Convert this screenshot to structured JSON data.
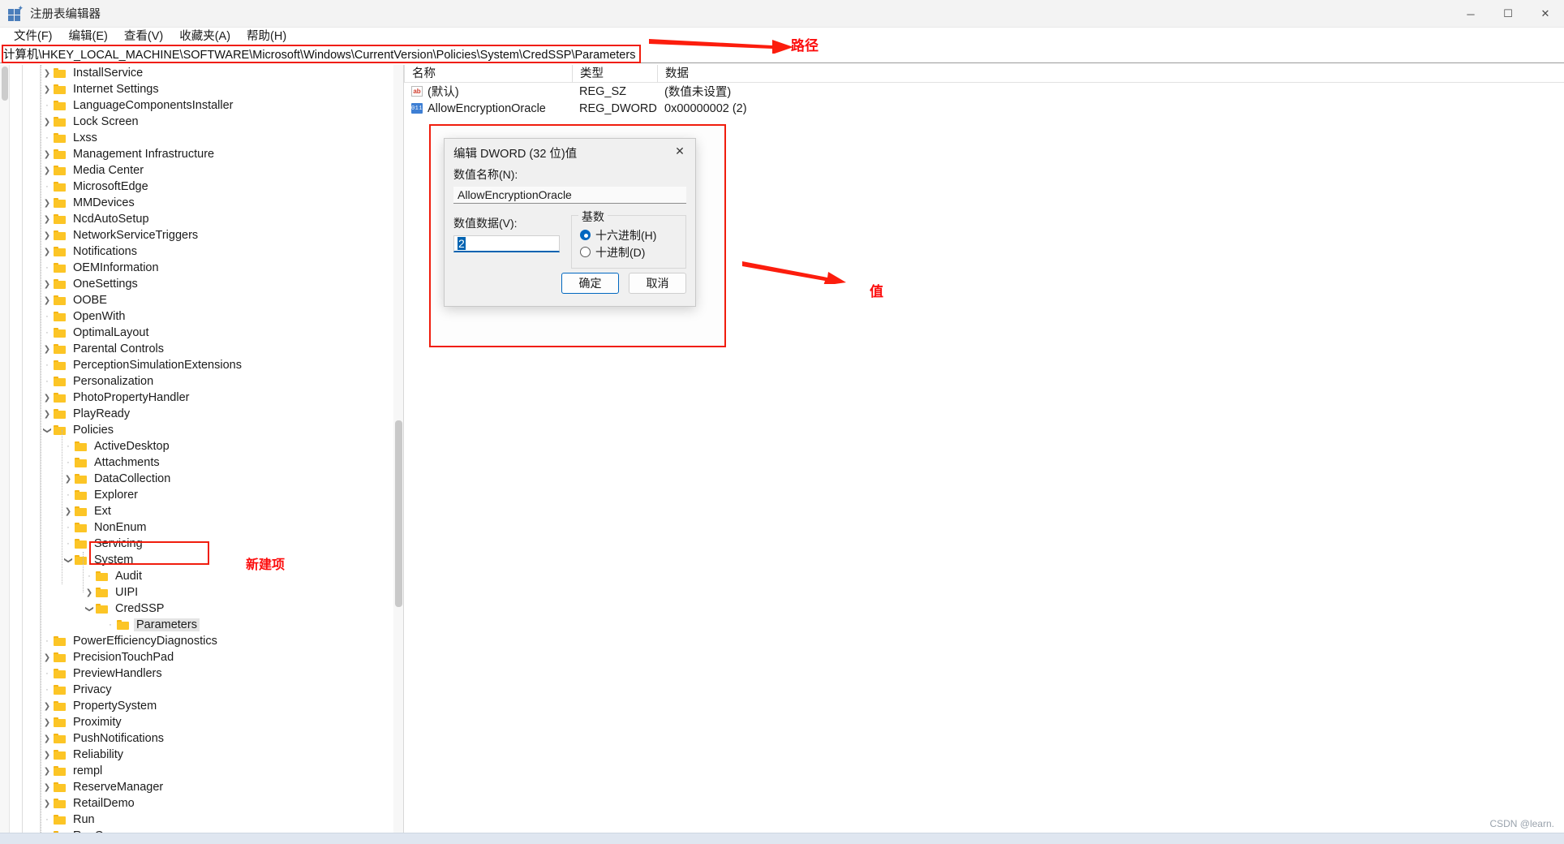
{
  "window": {
    "title": "注册表编辑器",
    "icon": "registry-icon",
    "controls": {
      "minimize": "─",
      "maximize": "☐",
      "close": "✕"
    }
  },
  "menubar": {
    "items": [
      {
        "label": "文件(F)",
        "name": "menu-file"
      },
      {
        "label": "编辑(E)",
        "name": "menu-edit"
      },
      {
        "label": "查看(V)",
        "name": "menu-view"
      },
      {
        "label": "收藏夹(A)",
        "name": "menu-favorites"
      },
      {
        "label": "帮助(H)",
        "name": "menu-help"
      }
    ]
  },
  "address": {
    "path": "计算机\\HKEY_LOCAL_MACHINE\\SOFTWARE\\Microsoft\\Windows\\CurrentVersion\\Policies\\System\\CredSSP\\Parameters",
    "placeholder": "计算机\\"
  },
  "tree": {
    "nodes": [
      {
        "label": "InstallService",
        "indent": 1,
        "expander": "collapsed"
      },
      {
        "label": "Internet Settings",
        "indent": 1,
        "expander": "collapsed"
      },
      {
        "label": "LanguageComponentsInstaller",
        "indent": 1,
        "expander": "none"
      },
      {
        "label": "Lock Screen",
        "indent": 1,
        "expander": "collapsed"
      },
      {
        "label": "Lxss",
        "indent": 1,
        "expander": "none"
      },
      {
        "label": "Management Infrastructure",
        "indent": 1,
        "expander": "collapsed"
      },
      {
        "label": "Media Center",
        "indent": 1,
        "expander": "collapsed"
      },
      {
        "label": "MicrosoftEdge",
        "indent": 1,
        "expander": "none"
      },
      {
        "label": "MMDevices",
        "indent": 1,
        "expander": "collapsed"
      },
      {
        "label": "NcdAutoSetup",
        "indent": 1,
        "expander": "collapsed"
      },
      {
        "label": "NetworkServiceTriggers",
        "indent": 1,
        "expander": "collapsed"
      },
      {
        "label": "Notifications",
        "indent": 1,
        "expander": "collapsed"
      },
      {
        "label": "OEMInformation",
        "indent": 1,
        "expander": "none"
      },
      {
        "label": "OneSettings",
        "indent": 1,
        "expander": "collapsed"
      },
      {
        "label": "OOBE",
        "indent": 1,
        "expander": "collapsed"
      },
      {
        "label": "OpenWith",
        "indent": 1,
        "expander": "none"
      },
      {
        "label": "OptimalLayout",
        "indent": 1,
        "expander": "none"
      },
      {
        "label": "Parental Controls",
        "indent": 1,
        "expander": "collapsed"
      },
      {
        "label": "PerceptionSimulationExtensions",
        "indent": 1,
        "expander": "none"
      },
      {
        "label": "Personalization",
        "indent": 1,
        "expander": "none"
      },
      {
        "label": "PhotoPropertyHandler",
        "indent": 1,
        "expander": "collapsed"
      },
      {
        "label": "PlayReady",
        "indent": 1,
        "expander": "collapsed"
      },
      {
        "label": "Policies",
        "indent": 1,
        "expander": "expanded"
      },
      {
        "label": "ActiveDesktop",
        "indent": 2,
        "expander": "none"
      },
      {
        "label": "Attachments",
        "indent": 2,
        "expander": "none"
      },
      {
        "label": "DataCollection",
        "indent": 2,
        "expander": "collapsed"
      },
      {
        "label": "Explorer",
        "indent": 2,
        "expander": "none"
      },
      {
        "label": "Ext",
        "indent": 2,
        "expander": "collapsed"
      },
      {
        "label": "NonEnum",
        "indent": 2,
        "expander": "none"
      },
      {
        "label": "Servicing",
        "indent": 2,
        "expander": "none"
      },
      {
        "label": "System",
        "indent": 2,
        "expander": "expanded"
      },
      {
        "label": "Audit",
        "indent": 3,
        "expander": "none"
      },
      {
        "label": "UIPI",
        "indent": 3,
        "expander": "collapsed"
      },
      {
        "label": "CredSSP",
        "indent": 3,
        "expander": "expanded"
      },
      {
        "label": "Parameters",
        "indent": 4,
        "expander": "none",
        "selected": true
      },
      {
        "label": "PowerEfficiencyDiagnostics",
        "indent": 1,
        "expander": "none"
      },
      {
        "label": "PrecisionTouchPad",
        "indent": 1,
        "expander": "collapsed"
      },
      {
        "label": "PreviewHandlers",
        "indent": 1,
        "expander": "none"
      },
      {
        "label": "Privacy",
        "indent": 1,
        "expander": "none"
      },
      {
        "label": "PropertySystem",
        "indent": 1,
        "expander": "collapsed"
      },
      {
        "label": "Proximity",
        "indent": 1,
        "expander": "collapsed"
      },
      {
        "label": "PushNotifications",
        "indent": 1,
        "expander": "collapsed"
      },
      {
        "label": "Reliability",
        "indent": 1,
        "expander": "collapsed"
      },
      {
        "label": "rempl",
        "indent": 1,
        "expander": "collapsed"
      },
      {
        "label": "ReserveManager",
        "indent": 1,
        "expander": "collapsed"
      },
      {
        "label": "RetailDemo",
        "indent": 1,
        "expander": "collapsed"
      },
      {
        "label": "Run",
        "indent": 1,
        "expander": "none"
      },
      {
        "label": "RunOnce",
        "indent": 1,
        "expander": "none"
      }
    ]
  },
  "valuelist": {
    "columns": {
      "name": "名称",
      "type": "类型",
      "data": "数据"
    },
    "rows": [
      {
        "icon": "string-value-icon",
        "name": "(默认)",
        "type": "REG_SZ",
        "data": "(数值未设置)"
      },
      {
        "icon": "dword-value-icon",
        "name": "AllowEncryptionOracle",
        "type": "REG_DWORD",
        "data": "0x00000002 (2)"
      }
    ]
  },
  "dialog": {
    "title": "编辑 DWORD (32 位)值",
    "close_glyph": "✕",
    "name_label": "数值名称(N):",
    "name_value": "AllowEncryptionOracle",
    "data_label": "数值数据(V):",
    "data_value": "2",
    "base_group": "基数",
    "radios": [
      {
        "label": "十六进制(H)",
        "selected": true
      },
      {
        "label": "十进制(D)",
        "selected": false
      }
    ],
    "ok_label": "确定",
    "cancel_label": "取消"
  },
  "annotations": [
    {
      "text": "路径",
      "name": "annotation-path"
    },
    {
      "text": "值",
      "name": "annotation-value"
    },
    {
      "text": "新建项",
      "name": "annotation-new-key"
    }
  ],
  "watermark": "CSDN @learn.",
  "colors": {
    "annotation_red": "#fc0d0d",
    "box_red": "#f01d0d",
    "accent_blue": "#0067c0",
    "folder_yellow": "#fcc526"
  }
}
